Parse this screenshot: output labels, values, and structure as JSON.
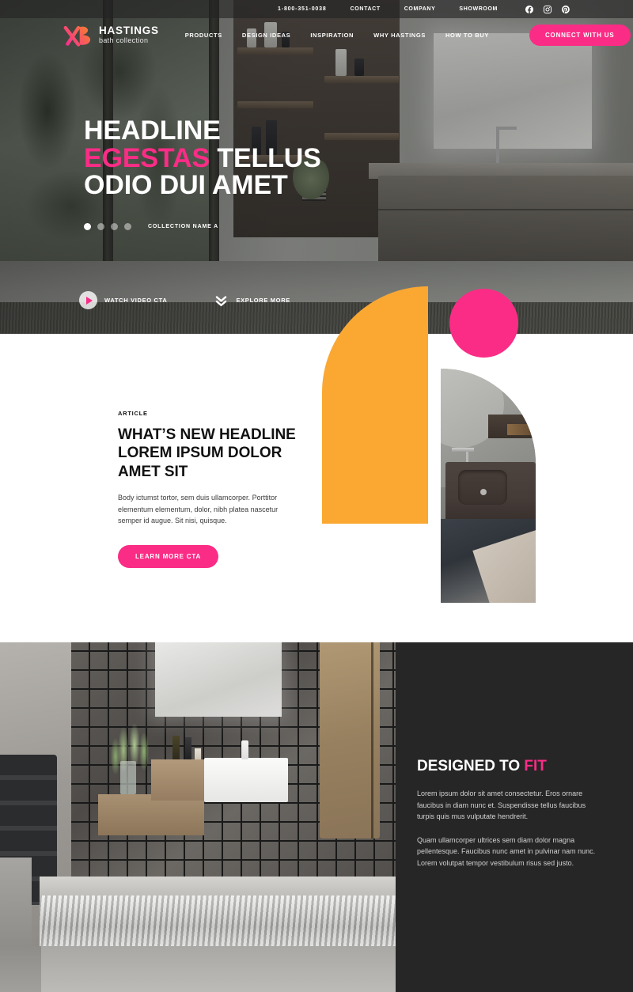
{
  "topbar": {
    "phone": "1-800-351-0038",
    "links": [
      {
        "label": "CONTACT"
      },
      {
        "label": "COMPANY"
      },
      {
        "label": "SHOWROOM"
      }
    ],
    "social": [
      {
        "name": "facebook-icon"
      },
      {
        "name": "instagram-icon"
      },
      {
        "name": "pinterest-icon"
      }
    ]
  },
  "brand": {
    "name": "HASTINGS",
    "tagline": "bath collection",
    "logo_gradient_from": "#f5249a",
    "logo_gradient_to": "#f6901e"
  },
  "nav": {
    "items": [
      {
        "label": "PRODUCTS"
      },
      {
        "label": "DESIGN IDEAS"
      },
      {
        "label": "INSPIRATION"
      },
      {
        "label": "WHY HASTINGS"
      },
      {
        "label": "HOW TO BUY"
      }
    ],
    "connect_label": "CONNECT WITH US",
    "search_icon": "search-icon",
    "wishlist_icon": "heart-icon"
  },
  "hero": {
    "headline_line1": "HEADLINE",
    "headline_line2_pink": "EGESTAS",
    "headline_line2_rest": " TELLUS",
    "headline_line3": "ODIO DUI AMET",
    "collection_name": "COLLECTION NAME A",
    "dots": [
      {
        "active": true
      },
      {
        "active": false
      },
      {
        "active": false
      },
      {
        "active": false
      }
    ],
    "watch_video_label": "WATCH VIDEO CTA",
    "explore_more_label": "EXPLORE MORE"
  },
  "article": {
    "eyebrow": "ARTICLE",
    "headline": "WHAT’S NEW HEADLINE LOREM IPSUM DOLOR AMET SIT",
    "body": "Body ictumst tortor, sem duis ullamcorper. Porttitor elementum elementum, dolor, nibh platea nascetur semper id augue. Sit nisi, quisque.",
    "cta_label": "LEARN MORE CTA"
  },
  "fit": {
    "title_main": "DESIGNED TO ",
    "title_accent": "FIT",
    "paragraph1": "Lorem ipsum dolor sit amet consectetur. Eros ornare faucibus in diam nunc et. Suspendisse tellus faucibus turpis quis mus vulputate hendrerit.",
    "paragraph2": "Quam ullamcorper ultrices sem diam dolor magna pellentesque. Faucibus nunc amet in pulvinar nam nunc. Lorem volutpat tempor vestibulum risus sed justo."
  },
  "colors": {
    "pink": "#fb2c86",
    "orange": "#faa832",
    "dark_panel": "#262626",
    "white": "#ffffff"
  }
}
